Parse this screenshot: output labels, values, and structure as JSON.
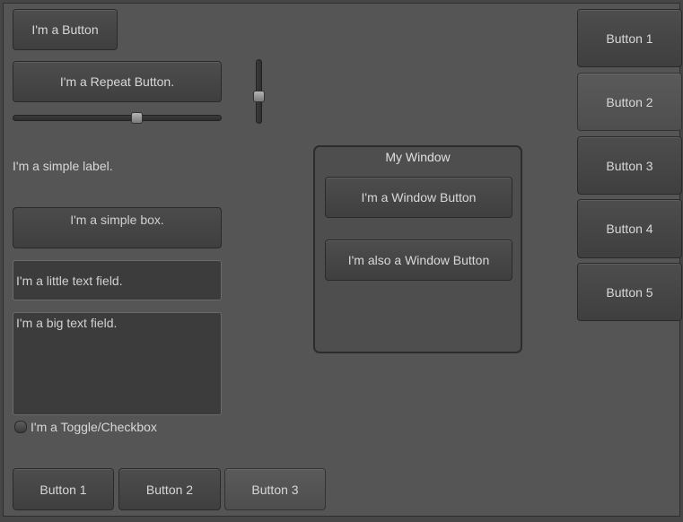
{
  "buttons": {
    "simple": "I'm a Button",
    "repeat": "I'm a Repeat Button."
  },
  "slider_h": {
    "value": 0.6
  },
  "slider_v": {
    "value": 0.6
  },
  "label": "I'm a simple label.",
  "box": "I'm a simple box.",
  "text_field": {
    "value": "I'm a little text field."
  },
  "text_area": {
    "value": "I'm a big text field."
  },
  "toggle": {
    "label": "I'm a Toggle/Checkbox",
    "checked": false
  },
  "window": {
    "title": "My Window",
    "button1": "I'm a Window Button",
    "button2": "I'm also a Window Button"
  },
  "toolbar_bottom": {
    "items": [
      "Button 1",
      "Button 2",
      "Button 3"
    ],
    "selected": 2
  },
  "selection_grid": {
    "items": [
      "Button 1",
      "Button 2",
      "Button 3",
      "Button 4",
      "Button 5"
    ],
    "selected": 1
  }
}
